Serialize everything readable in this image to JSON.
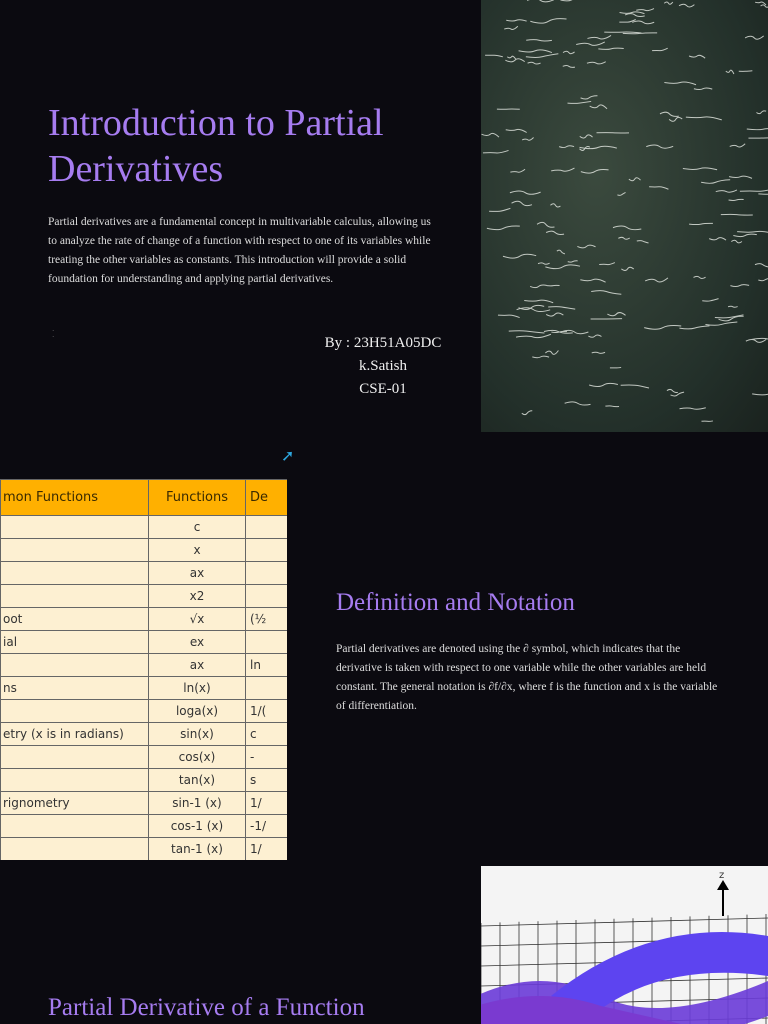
{
  "intro": {
    "title": "Introduction to Partial Derivatives",
    "body": " Partial derivatives are a fundamental concept in multivariable calculus, allowing us to analyze the rate of change of a function with respect to one of its variables while treating the other variables as constants. This introduction will provide a solid foundation for understanding and applying partial derivatives.",
    "author_lines": [
      "By : 23H51A05DC",
      "k.Satish",
      "CSE-01"
    ]
  },
  "table": {
    "headers": [
      "mon Functions",
      "Functions",
      "De"
    ],
    "rows": [
      [
        "",
        "c",
        ""
      ],
      [
        "",
        "x",
        ""
      ],
      [
        "",
        "ax",
        ""
      ],
      [
        "",
        "x2",
        ""
      ],
      [
        "oot",
        "√x",
        "(½"
      ],
      [
        "ial",
        "ex",
        ""
      ],
      [
        "",
        "ax",
        "ln"
      ],
      [
        "ns",
        "ln(x)",
        ""
      ],
      [
        "",
        "loga(x)",
        "1/("
      ],
      [
        "etry (x is in radians)",
        "sin(x)",
        "c"
      ],
      [
        "",
        "cos(x)",
        "-"
      ],
      [
        "",
        "tan(x)",
        "s"
      ],
      [
        "rignometry",
        "sin-1 (x)",
        "1/"
      ],
      [
        "",
        "cos-1 (x)",
        "-1/"
      ],
      [
        "",
        "tan-1 (x)",
        "1/"
      ]
    ]
  },
  "definition": {
    "title": "Definition and Notation",
    "body": " Partial derivatives are denoted using the ∂ symbol, which indicates that the derivative is taken with respect to one variable while the other variables are held constant. The general notation is ∂f/∂x, where f is the function and x is the variable of differentiation."
  },
  "plot": {
    "axis_label": "z"
  },
  "section3": {
    "title": "Partial Derivative of a Function"
  }
}
